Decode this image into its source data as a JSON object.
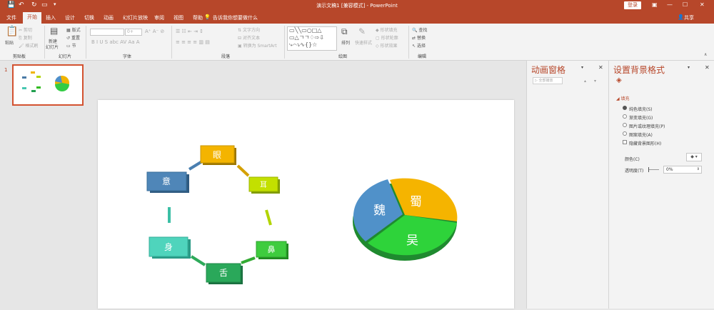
{
  "titlebar": {
    "title": "演示文稿1 [兼容模式] - PowerPoint",
    "login": "登录"
  },
  "tabs": [
    "文件",
    "开始",
    "插入",
    "设计",
    "切换",
    "动画",
    "幻灯片放映",
    "审阅",
    "视图",
    "帮助"
  ],
  "tellme": "告诉我你想要做什么",
  "share": "共享",
  "ribbon": {
    "clipboard": {
      "paste": "粘贴",
      "cut": "剪切",
      "copy": "复制",
      "format_painter": "格式刷",
      "label": "剪贴板"
    },
    "slides": {
      "new_slide": "新建",
      "new_slide2": "幻灯片",
      "layout": "版式",
      "reset": "重置",
      "section": "节",
      "label": "幻灯片"
    },
    "font": {
      "size": "0+",
      "label": "字体"
    },
    "paragraph": {
      "text_dir": "文字方向",
      "align_text": "对齐文本",
      "smartart": "转换为 SmartArt",
      "label": "段落"
    },
    "drawing": {
      "arrange": "排列",
      "quick_styles": "快速样式",
      "fill": "形状填充",
      "outline": "形状轮廓",
      "effects": "形状效果",
      "label": "绘图"
    },
    "editing": {
      "find": "查找",
      "replace": "替换",
      "select": "选择",
      "label": "编辑"
    }
  },
  "thumb": {
    "number": "1"
  },
  "slide": {
    "boxes": [
      {
        "text": "眼"
      },
      {
        "text": "耳"
      },
      {
        "text": "鼻"
      },
      {
        "text": "舌"
      },
      {
        "text": "身"
      },
      {
        "text": "意"
      }
    ],
    "pie": [
      {
        "label": "魏"
      },
      {
        "label": "蜀"
      },
      {
        "label": "吴"
      }
    ]
  },
  "anim_pane": {
    "title": "动画窗格",
    "play_all": "全部播放"
  },
  "bg_pane": {
    "title": "设置背景格式",
    "section": "填充",
    "options": [
      "纯色填充(S)",
      "渐变填充(G)",
      "图片或纹理填充(P)",
      "图案填充(A)"
    ],
    "hide_bg": "隐藏背景图形(H)",
    "color_label": "颜色(C)",
    "transparency_label": "透明度(T)",
    "transparency": "0%"
  }
}
